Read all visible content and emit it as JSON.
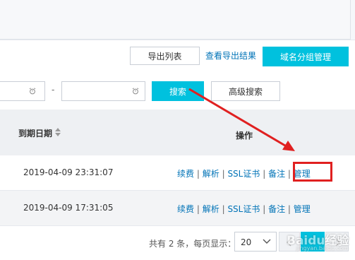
{
  "toolbar": {
    "export_list_label": "导出列表",
    "view_export_results_label": "查看导出结果",
    "domain_group_label": "域名分组管理"
  },
  "filter": {
    "date_separator": "-",
    "search_label": "搜索",
    "advanced_search_label": "高级搜索"
  },
  "table": {
    "headers": {
      "expiry_date": "到期日期",
      "operations": "操作"
    },
    "rows": [
      {
        "expiry": "2019-04-09 23:31:07",
        "ops": [
          "续费",
          "解析",
          "SSL证书",
          "备注",
          "管理"
        ]
      },
      {
        "expiry": "2019-04-09 17:31:05",
        "ops": [
          "续费",
          "解析",
          "SSL证书",
          "备注",
          "管理"
        ]
      }
    ],
    "op_separator": "|"
  },
  "pagination": {
    "summary": "共有 2 条，每页显示：",
    "page_size": "20"
  },
  "watermark": {
    "text": "Baidu经验",
    "sub": "jingyan.baidu.com"
  },
  "colors": {
    "accent": "#00c1de",
    "link": "#0073b7",
    "annotation": "#e02020"
  }
}
